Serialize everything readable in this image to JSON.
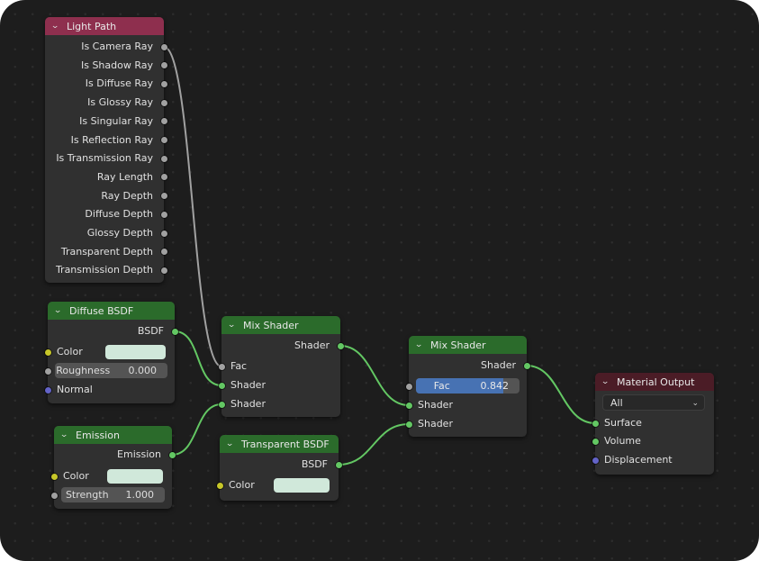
{
  "nodes": {
    "light_path": {
      "title": "Light Path",
      "outputs": [
        "Is Camera Ray",
        "Is Shadow Ray",
        "Is Diffuse Ray",
        "Is Glossy Ray",
        "Is Singular Ray",
        "Is Reflection Ray",
        "Is Transmission Ray",
        "Ray Length",
        "Ray Depth",
        "Diffuse Depth",
        "Glossy Depth",
        "Transparent Depth",
        "Transmission Depth"
      ]
    },
    "diffuse_bsdf": {
      "title": "Diffuse BSDF",
      "output": "BSDF",
      "color_label": "Color",
      "color_value": "#d0e8da",
      "roughness_label": "Roughness",
      "roughness_value": "0.000",
      "normal_label": "Normal"
    },
    "emission": {
      "title": "Emission",
      "output": "Emission",
      "color_label": "Color",
      "color_value": "#d0e8da",
      "strength_label": "Strength",
      "strength_value": "1.000"
    },
    "mix_shader_1": {
      "title": "Mix Shader",
      "output": "Shader",
      "fac_label": "Fac",
      "shader1_label": "Shader",
      "shader2_label": "Shader"
    },
    "transparent_bsdf": {
      "title": "Transparent BSDF",
      "output": "BSDF",
      "color_label": "Color",
      "color_value": "#d0e8da"
    },
    "mix_shader_2": {
      "title": "Mix Shader",
      "output": "Shader",
      "fac_label": "Fac",
      "fac_value": "0.842",
      "fac_fraction": 0.842,
      "shader1_label": "Shader",
      "shader2_label": "Shader"
    },
    "material_output": {
      "title": "Material Output",
      "target": "All",
      "surface_label": "Surface",
      "volume_label": "Volume",
      "displacement_label": "Displacement"
    }
  },
  "colors": {
    "header_input": "#8e2f4e",
    "header_shader": "#2b6b2b",
    "header_output": "#4b1c26",
    "socket_shader": "#63c763",
    "socket_float": "#a1a1a1",
    "socket_color": "#c7c729",
    "socket_vector": "#6363c7",
    "link_shader": "#63c763",
    "link_float": "#a1a1a1"
  },
  "links": [
    {
      "from": "light_path.Is Camera Ray",
      "to": "mix_shader_1.Fac",
      "type": "float"
    },
    {
      "from": "diffuse_bsdf.BSDF",
      "to": "mix_shader_1.Shader1",
      "type": "shader"
    },
    {
      "from": "emission.Emission",
      "to": "mix_shader_1.Shader2",
      "type": "shader"
    },
    {
      "from": "mix_shader_1.Shader",
      "to": "mix_shader_2.Shader1",
      "type": "shader"
    },
    {
      "from": "transparent_bsdf.BSDF",
      "to": "mix_shader_2.Shader2",
      "type": "shader"
    },
    {
      "from": "mix_shader_2.Shader",
      "to": "material_output.Surface",
      "type": "shader"
    }
  ]
}
